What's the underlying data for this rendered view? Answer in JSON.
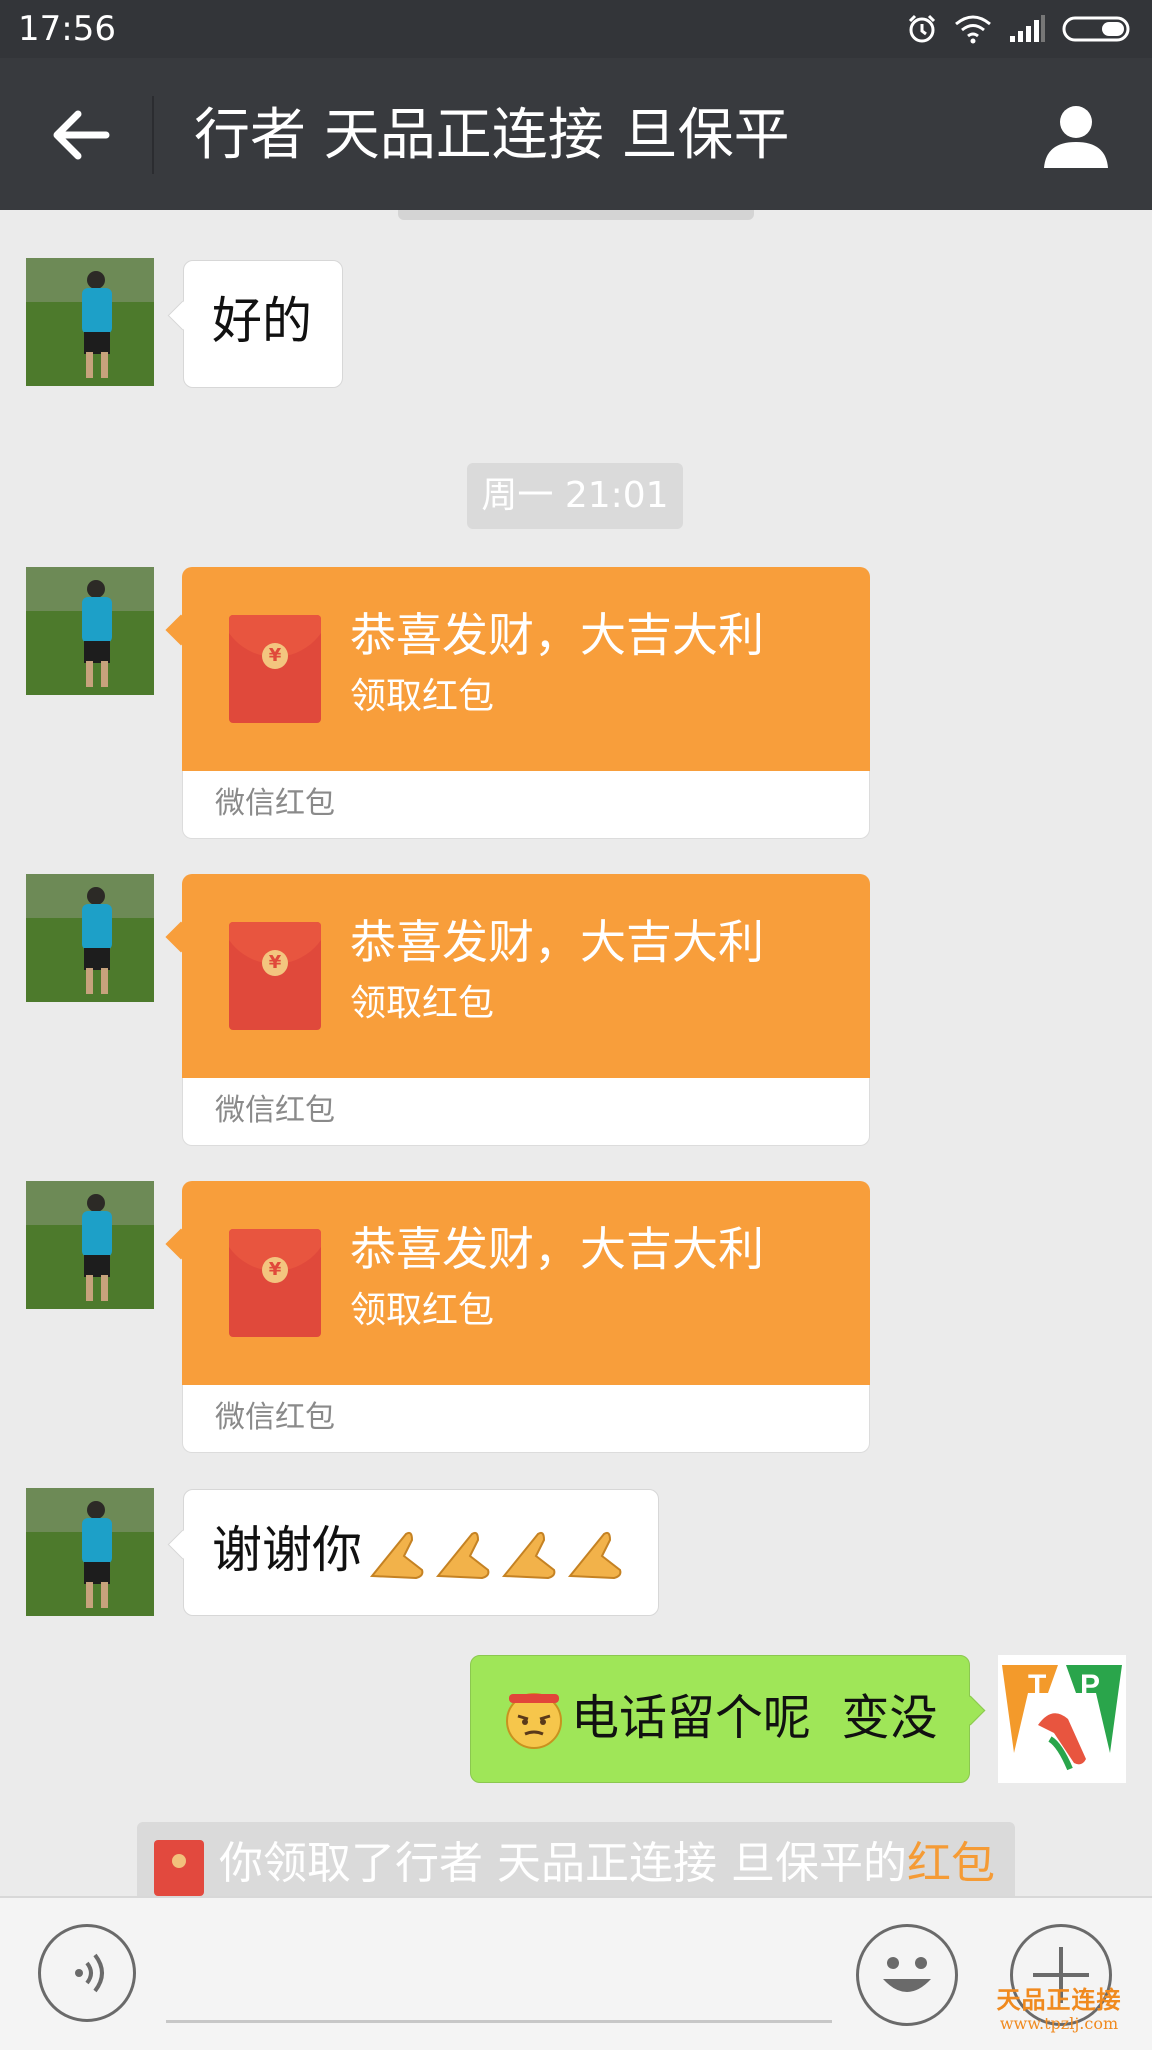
{
  "status_bar": {
    "time": "17:56"
  },
  "header": {
    "title": "行者 天品正连接 旦保平"
  },
  "messages": [
    {
      "sender": "other",
      "text": "好的"
    },
    {
      "timestamp": "周一 21:01"
    },
    {
      "sender": "other",
      "type": "red_packet",
      "greeting": "恭喜发财，大吉大利",
      "action": "领取红包",
      "footer": "微信红包"
    },
    {
      "sender": "other",
      "type": "red_packet",
      "greeting": "恭喜发财，大吉大利",
      "action": "领取红包",
      "footer": "微信红包"
    },
    {
      "sender": "other",
      "type": "red_packet",
      "greeting": "恭喜发财，大吉大利",
      "action": "领取红包",
      "footer": "微信红包"
    },
    {
      "sender": "other",
      "text": "谢谢你"
    },
    {
      "sender": "self",
      "text": "电话留个呢  变没"
    }
  ],
  "system_notice": {
    "text": "你领取了行者 天品正连接 旦保平的",
    "link": "红包"
  },
  "watermark": {
    "name": "天品正连接",
    "url": "www.tpzlj.com"
  },
  "colors": {
    "header": "#383a3e",
    "packet": "#f89e3b",
    "self_bubble": "#9fe658",
    "chat_bg": "#ebebeb"
  },
  "icons": [
    "back-arrow-icon",
    "profile-icon",
    "alarm-icon",
    "wifi-icon",
    "signal-icon",
    "battery-icon",
    "voice-icon",
    "emoji-icon",
    "plus-icon",
    "red-packet-icon",
    "praying-hands-icon",
    "annoyed-face-icon"
  ]
}
